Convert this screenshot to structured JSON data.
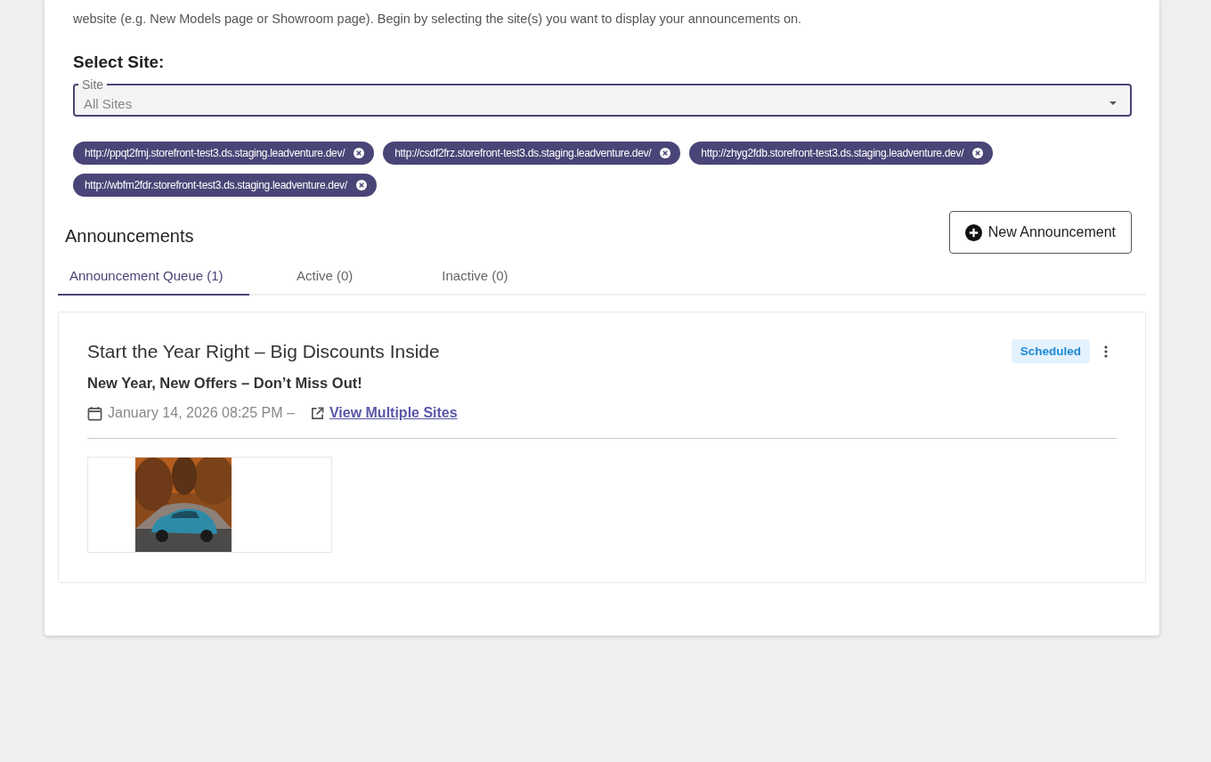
{
  "intro": "website (e.g. New Models page or Showroom page). Begin by selecting the site(s) you want to display your announcements on.",
  "select_site": {
    "heading": "Select Site:",
    "field": {
      "label": "Site",
      "value": "All Sites"
    }
  },
  "chips": [
    {
      "label": "http://ppqt2fmj.storefront-test3.ds.staging.leadventure.dev/"
    },
    {
      "label": "http://csdf2frz.storefront-test3.ds.staging.leadventure.dev/"
    },
    {
      "label": "http://zhyg2fdb.storefront-test3.ds.staging.leadventure.dev/"
    },
    {
      "label": "http://wbfm2fdr.storefront-test3.ds.staging.leadventure.dev/"
    }
  ],
  "announcements": {
    "heading": "Announcements",
    "new_button": "New Announcement",
    "tabs": [
      {
        "label": "Announcement Queue (1)",
        "selected": true
      },
      {
        "label": "Active (0)",
        "selected": false
      },
      {
        "label": "Inactive (0)",
        "selected": false
      }
    ],
    "items": [
      {
        "title": "Start the Year Right – Big Discounts Inside",
        "subtitle": "New Year, New Offers – Don’t Miss Out!",
        "date": "January 14, 2026 08:25 PM –",
        "link": "View Multiple Sites",
        "status": "Scheduled"
      }
    ]
  }
}
